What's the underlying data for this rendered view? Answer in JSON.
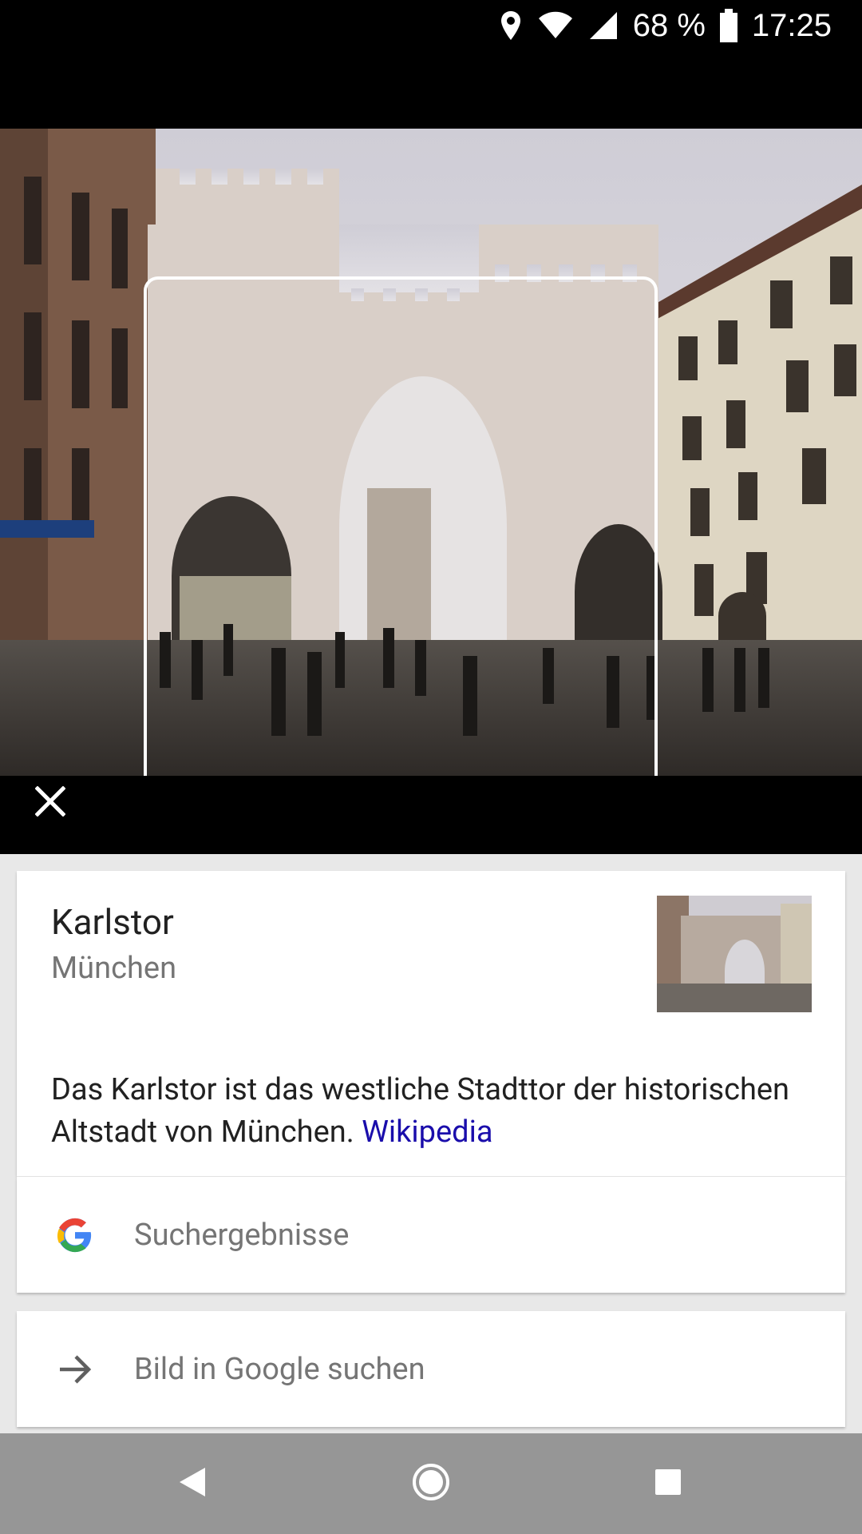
{
  "status_bar": {
    "battery": "68 %",
    "time": "17:25"
  },
  "result": {
    "title": "Karlstor",
    "subtitle": "München",
    "description": "Das Karlstor ist das westliche Stadttor der historischen Altstadt von München.",
    "source_link": "Wikipedia"
  },
  "actions": {
    "search_results": "Suchergebnisse",
    "search_image": "Bild in Google suchen"
  },
  "icons": {
    "close": "close-icon",
    "google": "google-g-icon",
    "arrow": "arrow-right-icon",
    "back": "nav-back-icon",
    "home": "nav-home-icon",
    "recents": "nav-recents-icon"
  },
  "colors": {
    "link": "#1a0dab",
    "nav_bar": "#969696"
  }
}
